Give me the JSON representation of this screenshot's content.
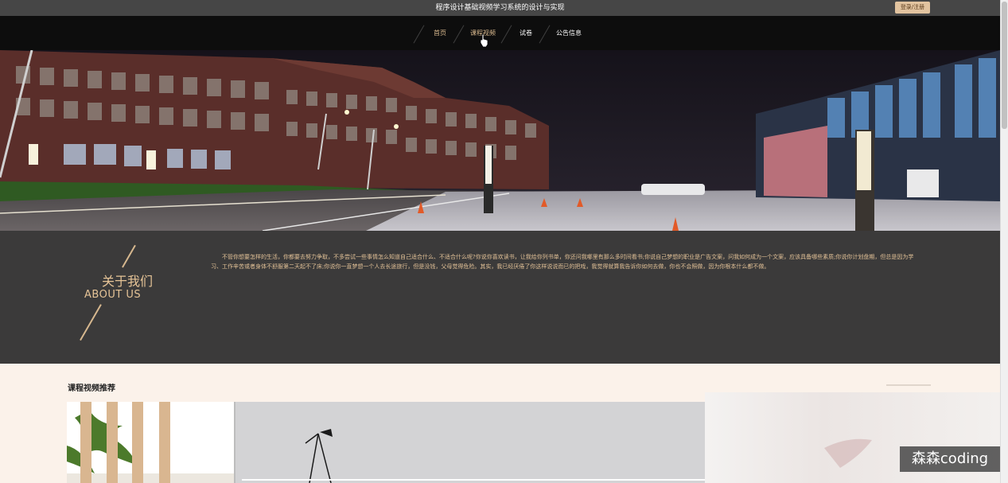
{
  "header": {
    "title": "程序设计基础视频学习系统的设计与实现",
    "login_label": "登录/注册"
  },
  "nav": {
    "items": [
      {
        "label": "首页"
      },
      {
        "label": "课程视频"
      },
      {
        "label": "试卷"
      },
      {
        "label": "公告信息"
      }
    ]
  },
  "banner": {
    "slide_count": 3,
    "active_slide": 1
  },
  "about": {
    "title_cn": "关于我们",
    "title_en": "ABOUT US",
    "body": "不管你想要怎样的生活，你都要去努力争取，不多尝试一些事情怎么知道自己适合什么、不适合什么呢?你说你喜欢读书，让我给你列书单，你还问我哪里有那么多时间看书;你说自己梦想的职业是广告文案，问我如何成为一个文案，应该具备哪些素质;你说你计划盘期，但总是因为学习、工作辛苦或者身体不舒服第二天起不了床;你说你一直梦想一个人去长途旅行，但是没钱，父母觉得危险。其实，我已经厌倦了你这样说说而已的把戏，我觉得就算我告诉你如何去做，你也不会照做，因为你根本什么都不做。"
  },
  "courses": {
    "section_title": "课程视频推荐"
  },
  "watermark": {
    "text": "森森coding"
  },
  "colors": {
    "accent_gold": "#e2c197",
    "nav_bg": "#0d0d0d",
    "about_bg": "#3b3a3a",
    "topbar_bg": "#464646"
  }
}
